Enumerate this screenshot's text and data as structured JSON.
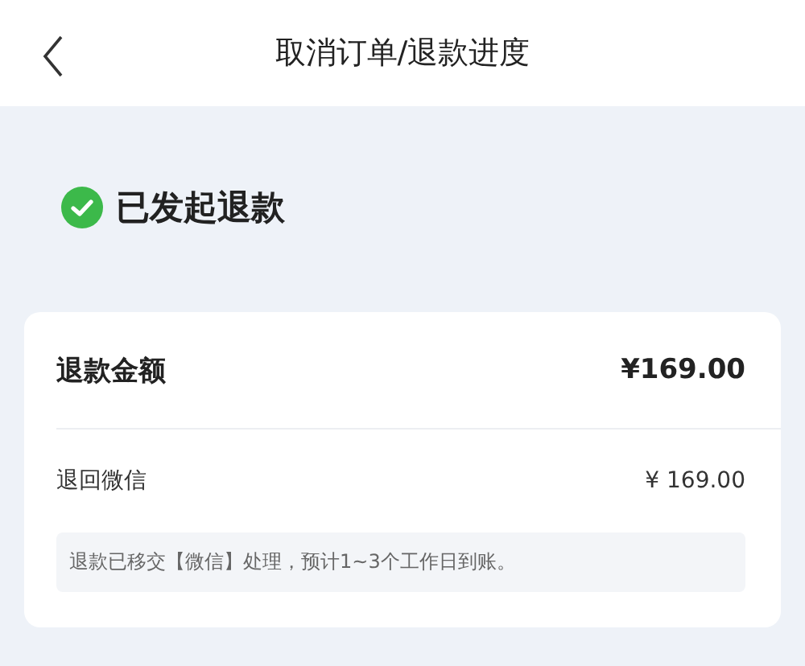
{
  "header": {
    "title": "取消订单/退款进度"
  },
  "status": {
    "text": "已发起退款"
  },
  "refund": {
    "label": "退款金额",
    "amount": "¥169.00"
  },
  "destination": {
    "label": "退回微信",
    "amount": "¥ 169.00"
  },
  "note": "退款已移交【微信】处理，预计1~3个工作日到账。"
}
